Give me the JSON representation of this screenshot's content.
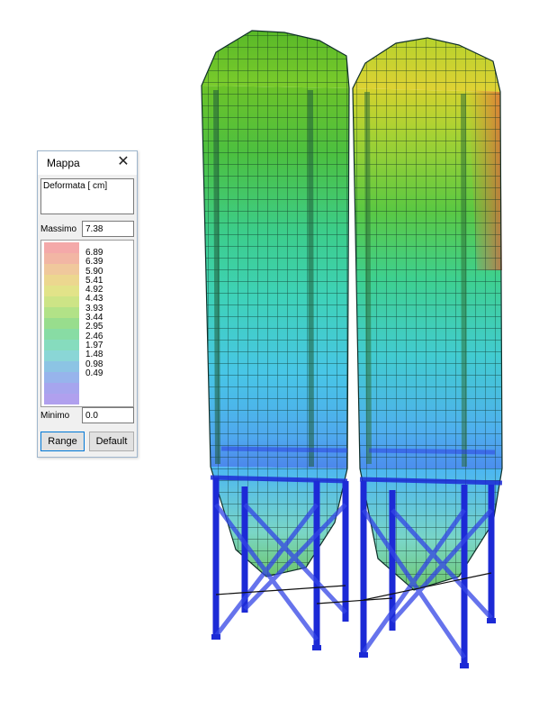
{
  "legend_window": {
    "title": "Mappa",
    "close_glyph": "✕",
    "result_label": "Deformata [ cm]",
    "max_label": "Massimo",
    "max_value": "7.38",
    "min_label": "Minimo",
    "min_value": "0.0",
    "range_button": "Range",
    "default_button": "Default",
    "scale_values": [
      "6.89",
      "6.39",
      "5.90",
      "5.41",
      "4.92",
      "4.43",
      "3.93",
      "3.44",
      "2.95",
      "2.46",
      "1.97",
      "1.48",
      "0.98",
      "0.49"
    ],
    "scale_colors": [
      "#f4a9a9",
      "#f2b6a4",
      "#f0c89c",
      "#ecd78f",
      "#e2e389",
      "#cde486",
      "#b2e287",
      "#98dd8d",
      "#88dca4",
      "#86dcbe",
      "#8ad6d6",
      "#8cc4e4",
      "#97b4ec",
      "#a6a5ee",
      "#b0a0ee"
    ]
  },
  "model_view": {
    "colors": {
      "top_left": "#5cbf2a",
      "top_right": "#c9d834",
      "mid": "#3ccfa0",
      "lower": "#41b7e8",
      "hopper": "#5daaf0",
      "support_steel": "#1c2ad6",
      "ring_beam": "#2a3be0",
      "mesh": "#0a2a22",
      "warm_band": "#e07a34"
    }
  }
}
